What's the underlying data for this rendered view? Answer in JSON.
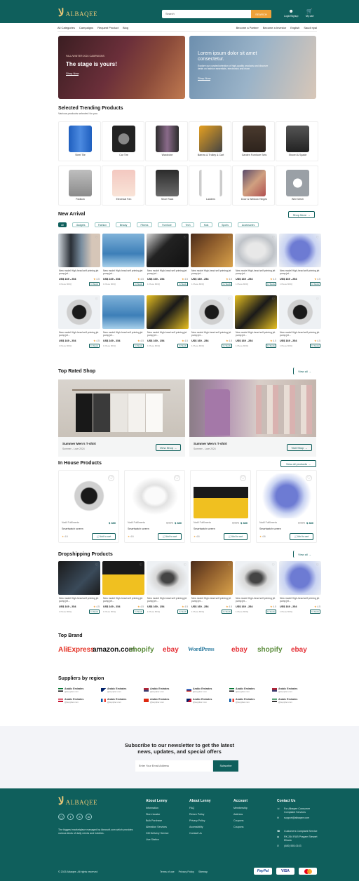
{
  "header": {
    "logo_text": "ALBAQEE",
    "logo_mark": "لا",
    "search_placeholder": "Search",
    "search_button": "SEARCH",
    "login_label": "Login/Signup",
    "cart_label": "My cart"
  },
  "nav": {
    "left": [
      "All Categories",
      "Campaigns",
      "Request Product",
      "Blog"
    ],
    "right": [
      "Become a Partner",
      "Become a Investor",
      "English",
      "Saudi riyal"
    ]
  },
  "banners": [
    {
      "kicker": "FALL/WINTER 2024 CAMPAIGNS",
      "title": "The stage is yours!",
      "cta": "Shop Now"
    },
    {
      "title": "Lorem ipsum dolor sit amet consectetur.",
      "body": "Explore our curated selection of high-quality products and discover deals on fashion essentials, electronics and more.",
      "cta": "Shop Now"
    }
  ],
  "trending": {
    "title": "Selected Trending Products",
    "subtitle": "Various products selected for you",
    "items": [
      "Steel Tile",
      "Car Tire",
      "Wardrobe",
      "Barrow & Trolley & Cart",
      "Garden Furniture Sets",
      "Shovel & Spade",
      "Padlock",
      "Electrical Fan",
      "Shoe Rack",
      "Ladders",
      "Door & Window Hinges",
      "Wire Mesh"
    ]
  },
  "new_arrival": {
    "title": "New Arrival",
    "shop_more": "Shop More",
    "filters": [
      "All",
      "Gadgets",
      "Fashion",
      "Beauty",
      "Fitness",
      "Furniture",
      "Tech",
      "Kids",
      "Sports",
      "Accessories"
    ],
    "card": {
      "title": "New model High-head self priming jet pump jet...",
      "price": "US$ 169 - 254",
      "rating": "4.5",
      "moq": "1 Piece MOQ",
      "tag": "In Stock"
    }
  },
  "top_rated": {
    "title": "Top Rated Shop",
    "view_all": "View all",
    "shops": [
      {
        "name": "Summer Men's T-shirt",
        "sub": "Summer - Love 2024",
        "cta": "View Shop"
      },
      {
        "name": "Summer Men's T-shirt",
        "sub": "Summer - Love 2024",
        "cta": "Visit Shop"
      }
    ]
  },
  "in_house": {
    "title": "In House Products",
    "view_all": "View all products",
    "cards": [
      {
        "store": "Nadil Fulfilments",
        "price": "$ 380",
        "old": "",
        "name": "Smartwatch screen",
        "rating": "4.6",
        "btn": "Add to cart"
      },
      {
        "store": "Nadil Fulfilments",
        "price": "$ 380",
        "old": "$ 370",
        "name": "Smartwatch screen",
        "rating": "4.6",
        "btn": "Add to cart"
      },
      {
        "store": "Nadil Fulfilments",
        "price": "$ 380",
        "old": "$ 370",
        "name": "Smartwatch screen",
        "rating": "4.6",
        "btn": "Add to cart"
      },
      {
        "store": "Nadil Fulfilments",
        "price": "$ 380",
        "old": "$ 370",
        "name": "Smartwatch screen",
        "rating": "4.6",
        "btn": "Add to cart"
      }
    ]
  },
  "dropshipping": {
    "title": "Dropshipping Products",
    "view_all": "View all"
  },
  "brands": {
    "title": "Top Brand",
    "items": [
      "AliExpress",
      "amazon.com",
      "shopify",
      "ebay",
      "WordPress",
      "ebay",
      "shopify",
      "ebay"
    ]
  },
  "suppliers": {
    "title": "Suppliers by region",
    "items": [
      {
        "n": "Arabic Emirates",
        "s": "@supplier.com"
      },
      {
        "n": "Arabic Emirates",
        "s": "@supplier.com"
      },
      {
        "n": "Arabic Emirates",
        "s": "@supplier.com"
      },
      {
        "n": "Arabic Emirates",
        "s": "@supplier.com"
      },
      {
        "n": "Arabic Emirates",
        "s": "@supplier.com"
      },
      {
        "n": "Arabic Emirates",
        "s": "@supplier.com"
      },
      {
        "n": "Arabic Emirates",
        "s": "@supplier.com"
      },
      {
        "n": "Arabic Emirates",
        "s": "@supplier.com"
      },
      {
        "n": "Arabic Emirates",
        "s": "@supplier.com"
      },
      {
        "n": "Arabic Emirates",
        "s": "@supplier.com"
      },
      {
        "n": "Arabic Emirates",
        "s": "@supplier.com"
      },
      {
        "n": "Arabic Emirates",
        "s": "@supplier.com"
      }
    ]
  },
  "newsletter": {
    "title1": "Subscribe to our newsletter to get the latest",
    "title2": "news, updates, and special offers",
    "placeholder": "Enter Your Email Address",
    "button": "Subscribe"
  },
  "footer": {
    "tagline": "The biggest marketplace managed by Ideosoft.com which provides various kinds of daily needs and hobbies.",
    "col1": {
      "title": "About Lenny",
      "links": [
        "Information",
        "Store locator",
        "Bulk Purchase",
        "Alteration Services",
        "Gift Delivery Service",
        "Live Station"
      ]
    },
    "col2": {
      "title": "About Lenny",
      "links": [
        "FAQ",
        "Return Policy",
        "Privacy Policy",
        "Accessibility",
        "Contact Us"
      ]
    },
    "col3": {
      "title": "Account",
      "links": [
        "Membership",
        "Address",
        "Coupons",
        "Coupons"
      ]
    },
    "col4": {
      "title": "Contact Us",
      "lines": [
        "For Albaqee Consumer Complaint Services",
        "support@albaqee.com",
        "Customers Complaint Service",
        "RK-264 RUB Pragam Stewart Ellowa",
        "(480) 555-0103"
      ]
    },
    "copyright": "© 2025 Albaqee. All rights reserved",
    "bottom_links": [
      "Terms of use",
      "Privacy Policy",
      "Sitemap"
    ],
    "payments": [
      "PayPal",
      "VISA",
      "MC"
    ]
  },
  "colors": {
    "primary": "#0f5f5c",
    "accent": "#f0a23a",
    "gold": "#e9c777"
  }
}
